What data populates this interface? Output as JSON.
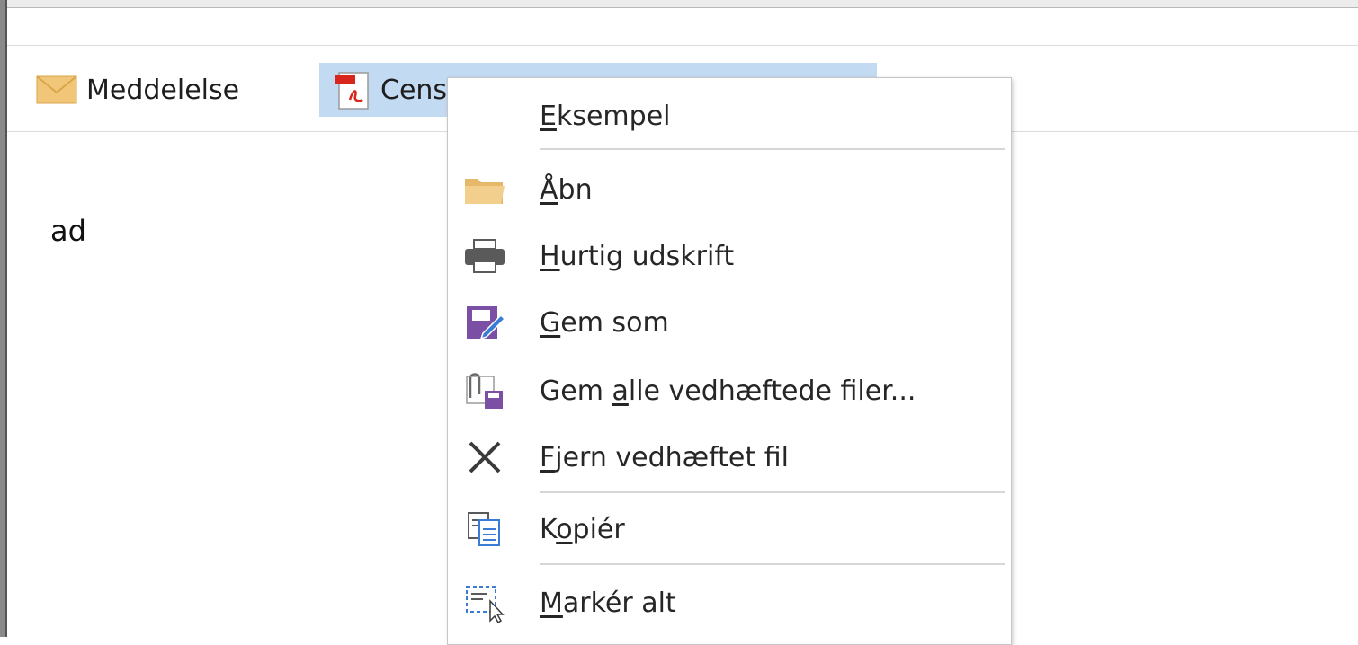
{
  "attachments": [
    {
      "name": "message-attachment",
      "label": "Meddelelse"
    },
    {
      "name": "pdf-attachment",
      "label": "Cens"
    }
  ],
  "body": {
    "text": "ad"
  },
  "context_menu": {
    "items": [
      {
        "pre": "",
        "key": "E",
        "post": "ksempel",
        "icon": "none"
      },
      {
        "pre": "",
        "key": "Å",
        "post": "bn",
        "icon": "folder-icon"
      },
      {
        "pre": "",
        "key": "H",
        "post": "urtig udskrift",
        "icon": "printer-icon"
      },
      {
        "pre": "",
        "key": "G",
        "post": "em som",
        "icon": "save-as-icon"
      },
      {
        "pre": "Gem ",
        "key": "a",
        "post": "lle vedhæftede filer...",
        "icon": "save-all-attachments-icon"
      },
      {
        "pre": "",
        "key": "F",
        "post": "jern vedhæftet fil",
        "icon": "remove-icon"
      },
      {
        "pre": "K",
        "key": "o",
        "post": "piér",
        "icon": "copy-icon"
      },
      {
        "pre": "",
        "key": "M",
        "post": "arkér alt",
        "icon": "select-all-icon"
      }
    ]
  },
  "colors": {
    "selection": "#c3daf3",
    "save_purple": "#7b4fa3",
    "folder": "#e8c27a",
    "pdf_red": "#d9261c"
  }
}
